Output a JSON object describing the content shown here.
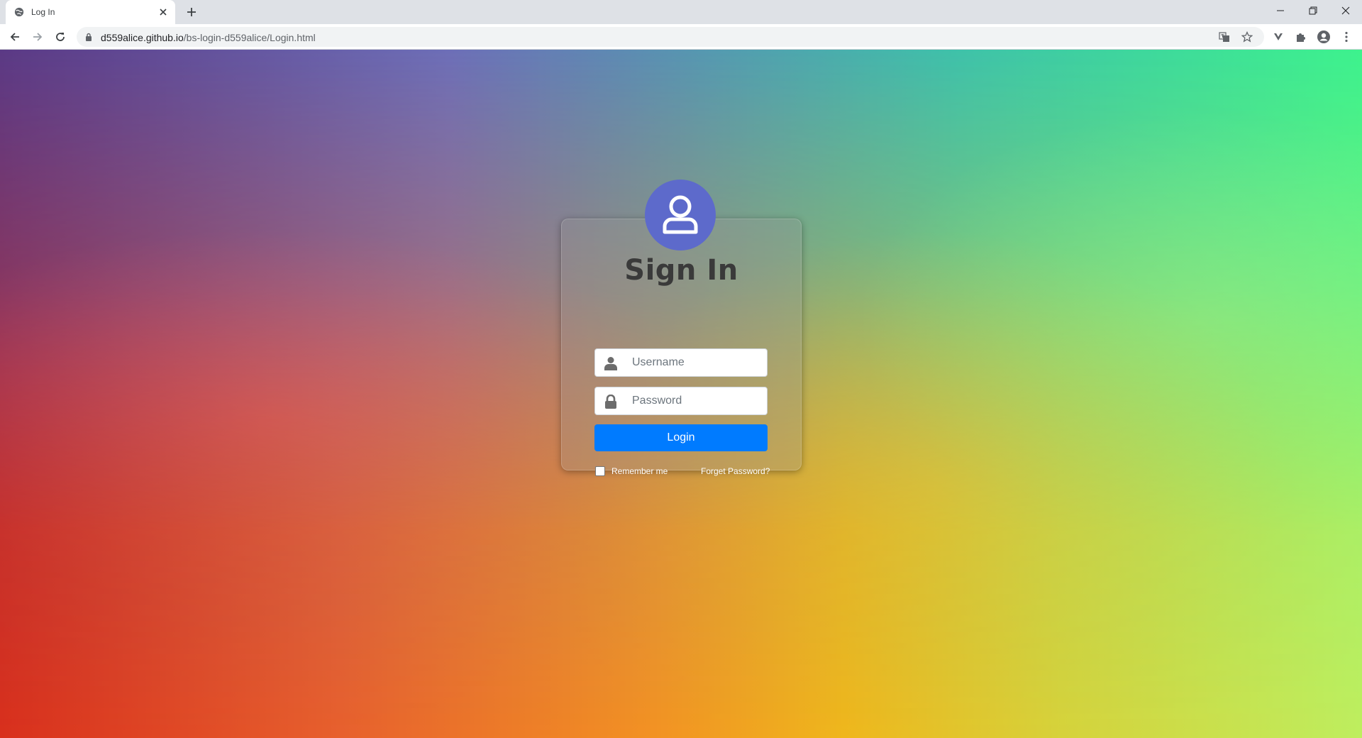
{
  "browser": {
    "tab_title": "Log In",
    "url_domain": "d559alice.github.io",
    "url_path": "/bs-login-d559alice/Login.html"
  },
  "page": {
    "title": "Sign In",
    "username_placeholder": "Username",
    "password_placeholder": "Password",
    "login_label": "Login",
    "remember_label": "Remember me",
    "forgot_label": "Forget Password?"
  },
  "colors": {
    "accent": "#007bff",
    "avatar_bg": "#5d6acb"
  }
}
